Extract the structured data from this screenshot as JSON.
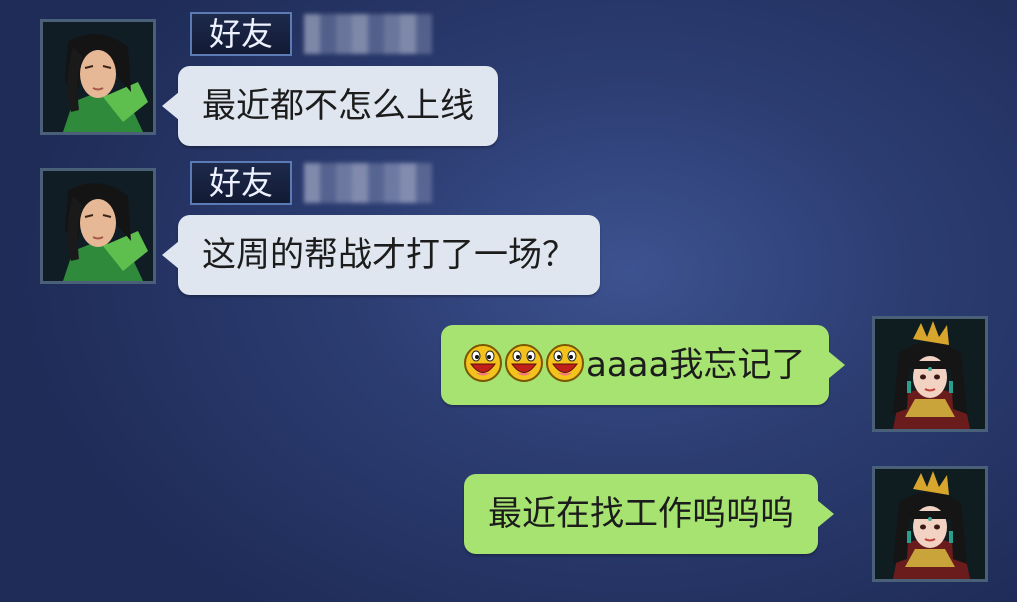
{
  "messages": [
    {
      "side": "left",
      "sender_tag": "好友",
      "text": "最近都不怎么上线",
      "avatar_icon": "male-swordsman-avatar-icon"
    },
    {
      "side": "left",
      "sender_tag": "好友",
      "text": "这周的帮战才打了一场？",
      "avatar_icon": "male-swordsman-avatar-icon"
    },
    {
      "side": "right",
      "emoji_icon": "laughing-face-emoji-icon",
      "text": "aaaa我忘记了",
      "avatar_icon": "female-character-avatar-icon"
    },
    {
      "side": "right",
      "text": "最近在找工作呜呜呜",
      "avatar_icon": "female-character-avatar-icon"
    }
  ],
  "colors": {
    "background": "#2c3d72",
    "left_bubble": "#dfe6ef",
    "right_bubble": "#a6e370",
    "badge_border": "#5b7bb5"
  }
}
